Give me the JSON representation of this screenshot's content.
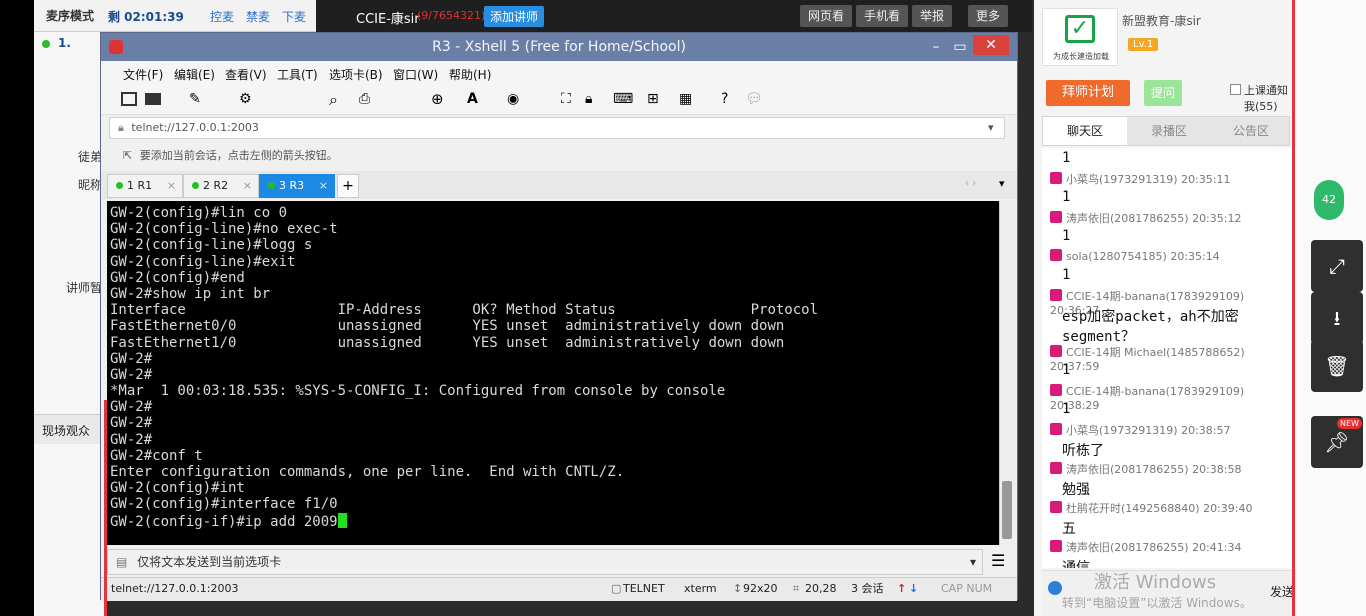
{
  "top_bar": {
    "mode_label": "麦序模式",
    "timer": "剩 02:01:39",
    "controls": [
      "控麦",
      "禁麦",
      "下麦"
    ],
    "channel_name": "CCIE-康sir",
    "channel_count": "(9/7654321)",
    "add_teacher": "添加讲师",
    "buttons": [
      "网页看",
      "手机看",
      "举报",
      "更多"
    ]
  },
  "left_strip": {
    "rank": "1.",
    "labels": [
      "徒弟",
      "昵称",
      "讲师暂"
    ],
    "section": "现场观众"
  },
  "xshell": {
    "title": "R3 - Xshell 5 (Free for Home/School)",
    "menu": [
      "文件(F)",
      "编辑(E)",
      "查看(V)",
      "工具(T)",
      "选项卡(B)",
      "窗口(W)",
      "帮助(H)"
    ],
    "address": "telnet://127.0.0.1:2003",
    "hint": "要添加当前会话，点击左侧的箭头按钮。",
    "tabs": [
      {
        "label": "1 R1"
      },
      {
        "label": "2 R2"
      },
      {
        "label": "3 R3"
      }
    ],
    "terminal_lines": [
      "GW-2(config)#lin co 0",
      "GW-2(config-line)#no exec-t",
      "GW-2(config-line)#logg s",
      "GW-2(config-line)#exit",
      "GW-2(config)#end",
      "GW-2#show ip int br",
      "Interface                  IP-Address      OK? Method Status                Protocol",
      "FastEthernet0/0            unassigned      YES unset  administratively down down",
      "FastEthernet1/0            unassigned      YES unset  administratively down down",
      "GW-2#",
      "GW-2#",
      "*Mar  1 00:03:18.535: %SYS-5-CONFIG_I: Configured from console by console",
      "GW-2#",
      "GW-2#",
      "GW-2#",
      "GW-2#conf t",
      "Enter configuration commands, one per line.  End with CNTL/Z.",
      "GW-2(config)#int",
      "GW-2(config)#interface f1/0",
      "GW-2(config-if)#ip add 2009"
    ],
    "send_bar": "仅将文本发送到当前选项卡",
    "status": {
      "address": "telnet://127.0.0.1:2003",
      "protocol": "TELNET",
      "term": "xterm",
      "size": "92x20",
      "pos": "20,28",
      "sessions": "3 会话",
      "keys": "CAP NUM"
    }
  },
  "right_panel": {
    "org_name": "新盟教育-康sir",
    "logo_caption": "为成长建造加载",
    "level": "Lv.1",
    "btn_plan": "拜师计划",
    "btn_flower": "提问",
    "notify": "上课通知我(55)",
    "tabs": [
      "聊天区",
      "录播区",
      "公告区"
    ],
    "chat": [
      {
        "name": "",
        "msg": "1"
      },
      {
        "name": "小菜鸟(1973291319) 20:35:11",
        "msg": "1"
      },
      {
        "name": "涛声依旧(2081786255) 20:35:12",
        "msg": "1"
      },
      {
        "name": "sola(1280754185) 20:35:14",
        "msg": "1"
      },
      {
        "name": "CCIE-14期-banana(1783929109) 20:36:27",
        "msg": "esp加密packet，ah不加密segment？"
      },
      {
        "name": "CCIE-14期 Michael(1485788652) 20:37:59",
        "msg": "1"
      },
      {
        "name": "CCIE-14期-banana(1783929109) 20:38:29",
        "msg": "1"
      },
      {
        "name": "小菜鸟(1973291319) 20:38:57",
        "msg": "听栋了"
      },
      {
        "name": "涛声依旧(2081786255) 20:38:58",
        "msg": "勉强"
      },
      {
        "name": "杜鹃花开时(1492568840) 20:39:40",
        "msg": "五"
      },
      {
        "name": "涛声依旧(2081786255) 20:41:34",
        "msg": "通信"
      }
    ],
    "send_label": "发送",
    "watermark_1": "激活 Windows",
    "watermark_2": "转到“电脑设置”以激活 Windows。"
  },
  "side_badge": "42",
  "new_badge": "NEW"
}
